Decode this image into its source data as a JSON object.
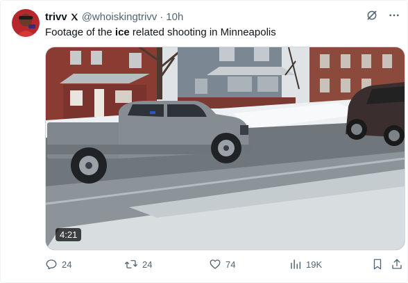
{
  "tweet": {
    "author_name": "trivv",
    "handle": "@whoiskingtrivv",
    "separator": "·",
    "time": "10h",
    "text_before": "Footage of the ",
    "text_bold": "ice",
    "text_after": " related shooting in Minneapolis"
  },
  "media": {
    "duration": "4:21"
  },
  "actions": {
    "replies": "24",
    "reposts": "24",
    "likes": "74",
    "views": "19K"
  },
  "icons": {
    "x_badge": "x-logo-icon",
    "grok": "grok-icon",
    "more": "more-icon",
    "reply": "reply-icon",
    "repost": "repost-icon",
    "like": "heart-icon",
    "views": "views-icon",
    "bookmark": "bookmark-icon",
    "share": "share-icon"
  },
  "colors": {
    "text_primary": "#0f1419",
    "text_secondary": "#536471",
    "border": "#cfd9de"
  }
}
